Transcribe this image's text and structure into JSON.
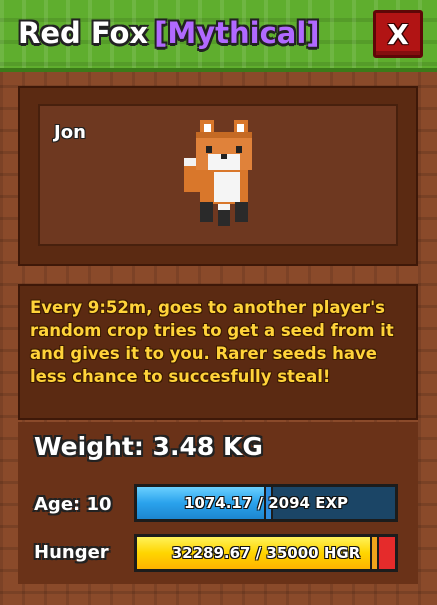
{
  "header": {
    "pet_name": "Red Fox",
    "rarity": "[Mythical]",
    "close_label": "X"
  },
  "pet": {
    "owner_name": "Jon",
    "image_icon": "red-fox-voxel-icon"
  },
  "description": "Every 9:52m, goes to another player's random crop tries to get a seed from it and gives it to you. Rarer seeds have less chance to succesfully steal!",
  "stats": {
    "weight_text": "Weight: 3.48 KG",
    "age_label": "Age: 10",
    "exp_text": "1074.17 / 2094 EXP",
    "exp_current": 1074.17,
    "exp_max": 2094,
    "hunger_label": "Hunger",
    "hunger_text": "32289.67 / 35000 HGR",
    "hunger_current": 32289.67,
    "hunger_max": 35000
  },
  "colors": {
    "rarity": "#b169ff",
    "description_text": "#ffd33a",
    "exp_fill": "#2aa2ec",
    "hunger_fill": "#ffd500",
    "hunger_empty": "#e52b2b",
    "close_button": "#b11414"
  }
}
